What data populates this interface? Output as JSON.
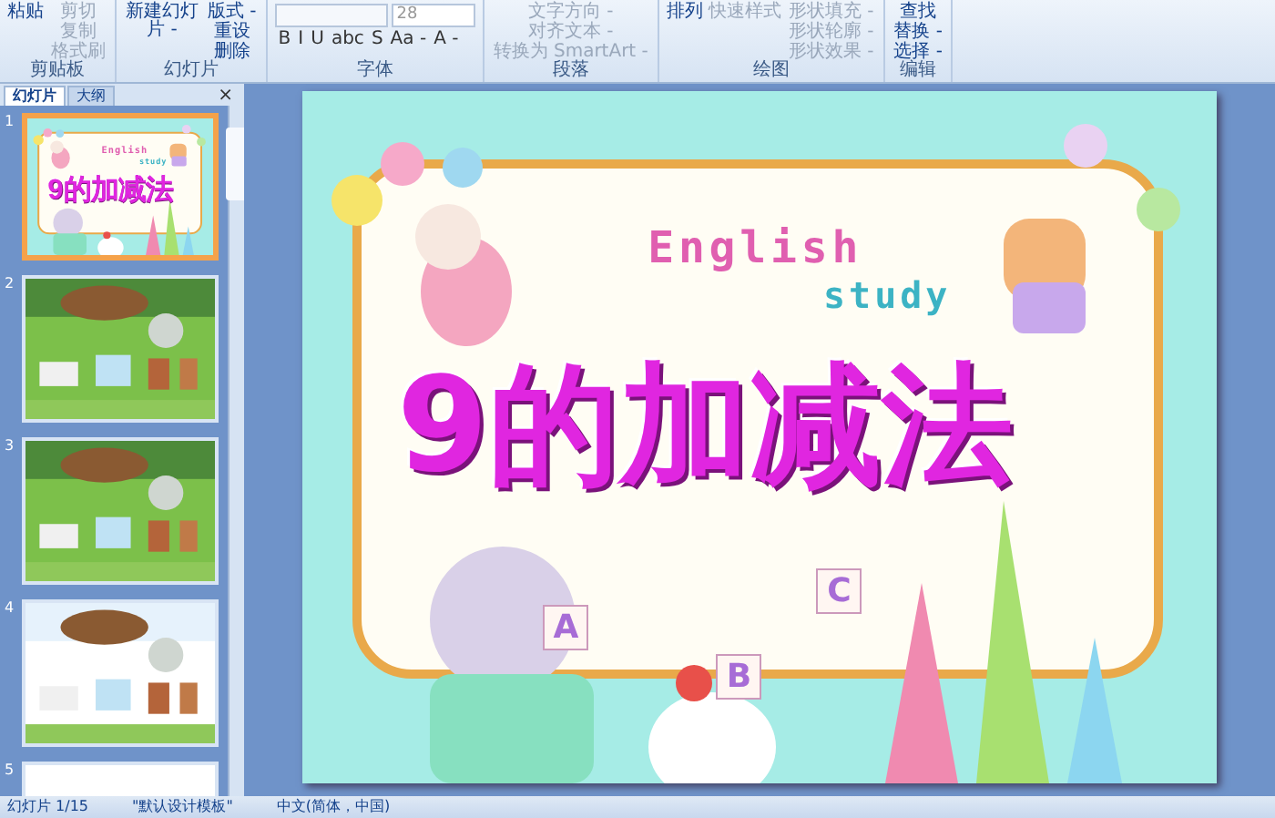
{
  "ribbon": {
    "groups": [
      {
        "label": "剪贴板",
        "items": [
          {
            "label": "粘贴",
            "kind": "large",
            "disabled": false
          },
          {
            "label": "剪切",
            "kind": "small",
            "disabled": true
          },
          {
            "label": "复制",
            "kind": "small",
            "disabled": true
          },
          {
            "label": "格式刷",
            "kind": "small",
            "disabled": true
          }
        ]
      },
      {
        "label": "幻灯片",
        "items": [
          {
            "label": "新建幻灯片 -",
            "kind": "large",
            "disabled": false
          },
          {
            "label": "版式 -",
            "kind": "small",
            "disabled": false
          },
          {
            "label": "重设",
            "kind": "small",
            "disabled": false
          },
          {
            "label": "删除",
            "kind": "small",
            "disabled": false
          }
        ]
      },
      {
        "label": "字体",
        "font_size": "28",
        "items": [
          {
            "label": "B",
            "kind": "glyph",
            "disabled": false
          },
          {
            "label": "I",
            "kind": "glyph",
            "disabled": false
          },
          {
            "label": "U",
            "kind": "glyph",
            "disabled": false
          },
          {
            "label": "abc",
            "kind": "glyph",
            "disabled": false
          },
          {
            "label": "S",
            "kind": "glyph",
            "disabled": false
          },
          {
            "label": "Aa -",
            "kind": "glyph",
            "disabled": false
          },
          {
            "label": "A -",
            "kind": "glyph",
            "disabled": false
          }
        ]
      },
      {
        "label": "段落",
        "items": [
          {
            "label": "文字方向 -",
            "kind": "small",
            "disabled": true
          },
          {
            "label": "对齐文本 -",
            "kind": "small",
            "disabled": true
          },
          {
            "label": "转换为 SmartArt -",
            "kind": "small",
            "disabled": true
          }
        ]
      },
      {
        "label": "绘图",
        "items": [
          {
            "label": "排列",
            "kind": "large",
            "disabled": false
          },
          {
            "label": "快速样式",
            "kind": "large",
            "disabled": true
          },
          {
            "label": "形状填充 -",
            "kind": "small",
            "disabled": true
          },
          {
            "label": "形状轮廓 -",
            "kind": "small",
            "disabled": true
          },
          {
            "label": "形状效果 -",
            "kind": "small",
            "disabled": true
          }
        ]
      },
      {
        "label": "编辑",
        "items": [
          {
            "label": "查找",
            "kind": "small",
            "disabled": false
          },
          {
            "label": "替换 -",
            "kind": "small",
            "disabled": false
          },
          {
            "label": "选择 -",
            "kind": "small",
            "disabled": false
          }
        ]
      }
    ]
  },
  "panel": {
    "tabs": [
      {
        "label": "幻灯片",
        "selected": true
      },
      {
        "label": "大纲",
        "selected": false
      }
    ],
    "close": "×",
    "thumbnails": [
      {
        "number": "1",
        "selected": true,
        "kind": "title",
        "english": "English",
        "study": "study",
        "title": "9的加减法"
      },
      {
        "number": "2",
        "selected": false,
        "kind": "picture"
      },
      {
        "number": "3",
        "selected": false,
        "kind": "picture"
      },
      {
        "number": "4",
        "selected": false,
        "kind": "picture"
      },
      {
        "number": "5",
        "selected": false,
        "kind": "blank"
      }
    ]
  },
  "slide": {
    "english": "English",
    "study": "study",
    "title": "9的加减法",
    "blocks": [
      "A",
      "B",
      "C"
    ]
  },
  "status_bar": {
    "slide": "幻灯片 1/15",
    "theme": "\"默认设计模板\"",
    "language": "中文(简体，中国)"
  }
}
